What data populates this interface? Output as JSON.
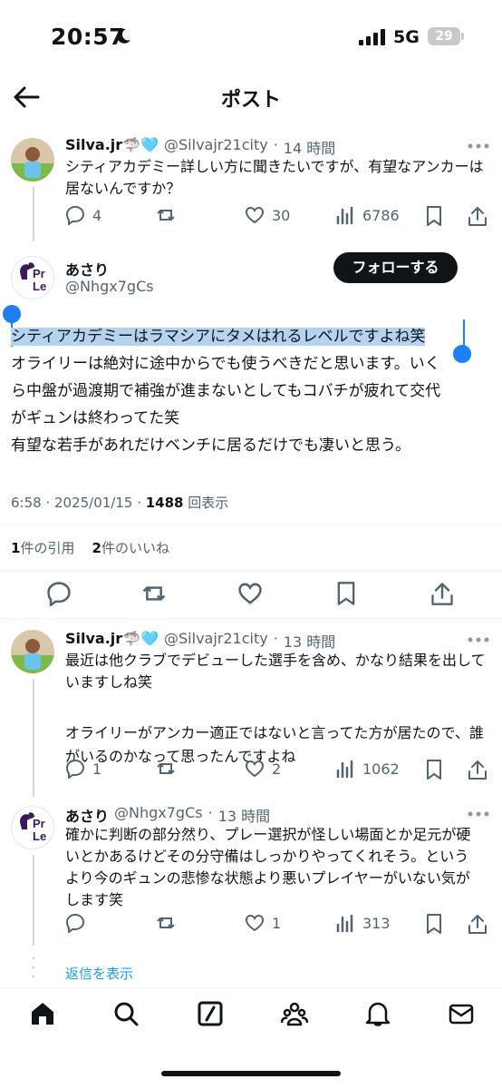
{
  "status_bar": {
    "time": "20:57",
    "network": "5G",
    "battery": "29"
  },
  "header": {
    "title": "ポスト"
  },
  "posts": [
    {
      "name": "Silva.jr🦈🩵",
      "handle": "@Silvajr21city",
      "time": "14 時間",
      "lines": [
        "シティアカデミー詳しい方に聞きたいですが、有望なアンカーは",
        "居ないんですか？"
      ],
      "replies": "4",
      "reposts": "",
      "likes": "30",
      "views": "6786"
    },
    {
      "name": "あさり",
      "handle": "@Nhgx7gCs",
      "follow_label": "フォローする",
      "lines": [
        "シティアカデミーはラマシアにタメはれるレベルですよね笑",
        "オライリーは絶対に途中からでも使うべきだと思います。いく",
        "ら中盤が過渡期で補強が進まないとしてもコバチが疲れて交代",
        "がギュンは終わってた笑",
        "有望な若手があれだけベンチに居るだけでも凄いと思う。"
      ],
      "timestamp": "6:58 · 2025/01/15 · ",
      "view_count": "1488",
      "view_label": "回表示",
      "quotes_count": "1",
      "quotes_label": "件の引用",
      "likes_count": "2",
      "likes_label": "件のいいね"
    },
    {
      "name": "Silva.jr🦈🩵",
      "handle": "@Silvajr21city",
      "time": "13 時間",
      "lines": [
        "最近は他クラブでデビューした選手を含め、かなり結果を出して",
        "いますしね笑",
        "",
        "オライリーがアンカー適正ではないと言ってた方が居たので、誰",
        "がいるのかなって思ったんですよね"
      ],
      "replies": "1",
      "reposts": "",
      "likes": "2",
      "views": "1062"
    },
    {
      "name": "あさり",
      "handle": "@Nhgx7gCs",
      "time": "13 時間",
      "lines": [
        "確かに判断の部分然り、プレー選択が怪しい場面とか足元が硬",
        "いとかあるけどその分守備はしっかりやってくれそう。という",
        "より今のギュンの悲惨な状態より悪いプレイヤーがいない気が",
        "します笑"
      ],
      "replies": "",
      "reposts": "",
      "likes": "1",
      "views": "313"
    }
  ],
  "show_replies": "返信を表示",
  "logo_text": [
    "Pr",
    "Le"
  ],
  "colors": {
    "accent": "#1d9bf0",
    "selection": "#b4d3ef",
    "caret": "#1d7ff0",
    "text": "#0f1419",
    "muted": "#536471"
  }
}
